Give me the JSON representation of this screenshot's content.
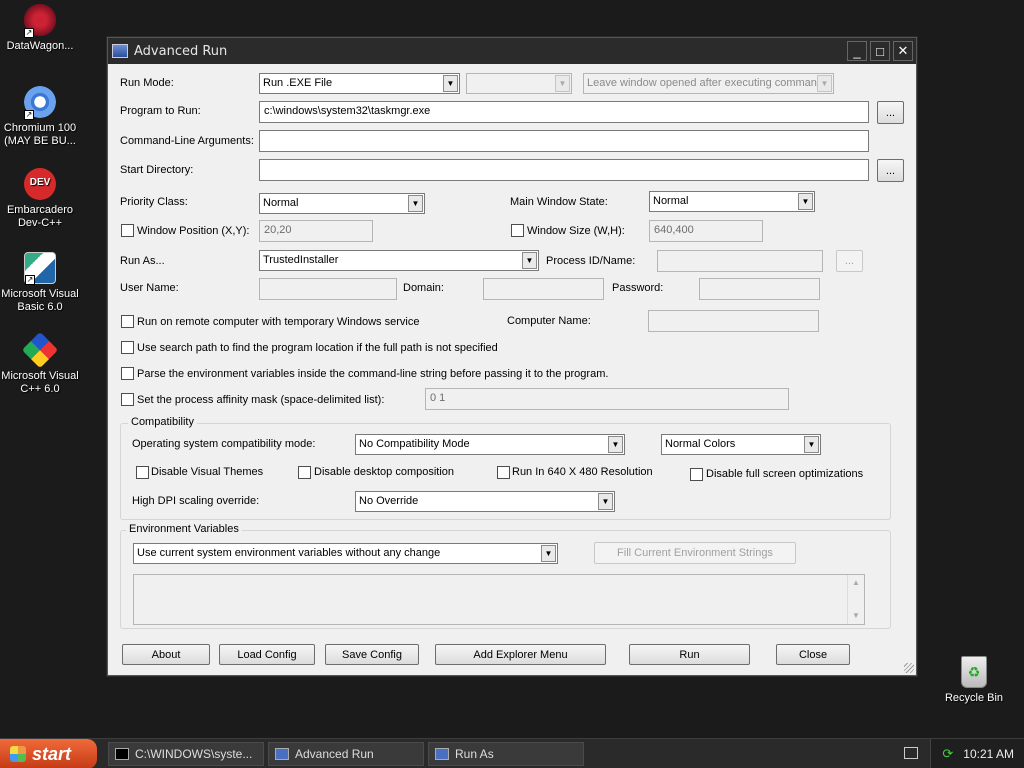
{
  "desktop": {
    "icons": [
      {
        "label": "DataWagon...",
        "icon": "datawagon-icon"
      },
      {
        "label": "Chromium 100 (MAY BE BU...",
        "icon": "chromium-icon"
      },
      {
        "label": "Embarcadero Dev-C++",
        "icon": "devcpp-icon",
        "badge": "DEV"
      },
      {
        "label": "Microsoft Visual Basic 6.0",
        "icon": "vb6-icon"
      },
      {
        "label": "Microsoft Visual C++ 6.0",
        "icon": "vc6-icon"
      }
    ],
    "recycle_bin": "Recycle Bin"
  },
  "window": {
    "title": "Advanced Run",
    "controls": {
      "minimize": "_",
      "maximize": "□",
      "close": "✕"
    }
  },
  "form": {
    "run_mode_label": "Run Mode:",
    "run_mode_value": "Run .EXE File",
    "leave_window_value": "Leave window opened after executing comman",
    "program_label": "Program to Run:",
    "program_value": "c:\\windows\\system32\\taskmgr.exe",
    "browse_label": "...",
    "cmdline_label": "Command-Line Arguments:",
    "cmdline_value": "",
    "startdir_label": "Start Directory:",
    "startdir_value": "",
    "priority_label": "Priority Class:",
    "priority_value": "Normal",
    "mainwin_label": "Main Window State:",
    "mainwin_value": "Normal",
    "winpos_label": "Window Position (X,Y):",
    "winpos_value": "20,20",
    "winsize_label": "Window Size (W,H):",
    "winsize_value": "640,400",
    "runas_label": "Run As...",
    "runas_value": "TrustedInstaller",
    "procid_label": "Process ID/Name:",
    "username_label": "User Name:",
    "domain_label": "Domain:",
    "password_label": "Password:",
    "remote_label": "Run on remote computer with temporary Windows service",
    "computer_name_label": "Computer Name:",
    "search_path_label": "Use search path to find the program location if the full path is not specified",
    "parse_env_label": "Parse the environment variables inside the command-line string before passing it to the program.",
    "affinity_label": "Set the process affinity mask (space-delimited list):",
    "affinity_value": "0 1"
  },
  "compat": {
    "title": "Compatibility",
    "os_mode_label": "Operating system compatibility mode:",
    "os_mode_value": "No Compatibility Mode",
    "colors_value": "Normal Colors",
    "disable_themes": "Disable Visual Themes",
    "disable_desktop": "Disable desktop composition",
    "run_640": "Run In 640 X 480 Resolution",
    "disable_fullscreen": "Disable full screen optimizations",
    "dpi_label": "High DPI scaling override:",
    "dpi_value": "No Override"
  },
  "env": {
    "title": "Environment Variables",
    "mode_value": "Use current system environment variables without any change",
    "fill_button": "Fill Current Environment Strings"
  },
  "buttons": {
    "about": "About",
    "load_config": "Load Config",
    "save_config": "Save Config",
    "add_explorer_menu": "Add Explorer Menu",
    "run": "Run",
    "close": "Close"
  },
  "taskbar": {
    "start": "start",
    "tasks": [
      "C:\\WINDOWS\\syste...",
      "Advanced Run",
      "Run As"
    ],
    "clock": "10:21 AM"
  },
  "colors": {
    "desktop_bg": "#1b1b1b",
    "window_bg": "#f0f0f0",
    "start_button": "#d9501f"
  }
}
